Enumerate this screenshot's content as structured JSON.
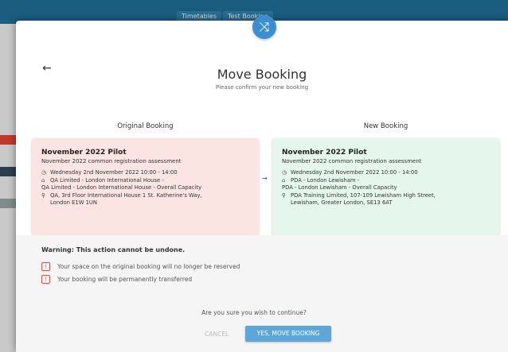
{
  "background": {
    "tabs": [
      "Timetables",
      "Test Booking"
    ]
  },
  "modal": {
    "title": "Move Booking",
    "subtitle": "Please confirm your new booking",
    "back_icon": "arrow-left-icon",
    "badge_icon": "shuffle-icon",
    "original": {
      "heading": "Original Booking",
      "title": "November 2022 Pilot",
      "subtitle": "November 2022 common registration assessment",
      "datetime": "Wednesday 2nd November 2022 10:00 - 14:00",
      "venue_line1": "QA Limited - London International House -",
      "venue_line2": "QA Limited - London International House - Overall Capacity",
      "address_line1": "QA, 3rd Floor International House 1 St. Katherine's Way,",
      "address_line2": "London E1W 1UN"
    },
    "new": {
      "heading": "New Booking",
      "title": "November 2022 Pilot",
      "subtitle": "November 2022 common registration assessment",
      "datetime": "Wednesday 2nd November 2022 10:00 - 14:00",
      "venue_line1": "PDA - London Lewisham -",
      "venue_line2": "PDA - London Lewisham - Overall Capacity",
      "address_line1": "PDA Training Limited, 107-109 Lewisham High Street,",
      "address_line2": "Lewisham, Greater London, SE13 6AT"
    },
    "warning": {
      "title": "Warning: This action cannot be undone.",
      "items": [
        "Your space on the original booking will no longer be reserved",
        "Your booking will be permanently transferred"
      ]
    },
    "confirm_question": "Are you sure you wish to continue?",
    "cancel_label": "CANCEL",
    "confirm_label": "YES, MOVE BOOKING"
  },
  "colors": {
    "original_card": "#fbe5e3",
    "new_card": "#e5f6ec",
    "accent": "#5aa7d8",
    "warning": "#d9534f"
  }
}
